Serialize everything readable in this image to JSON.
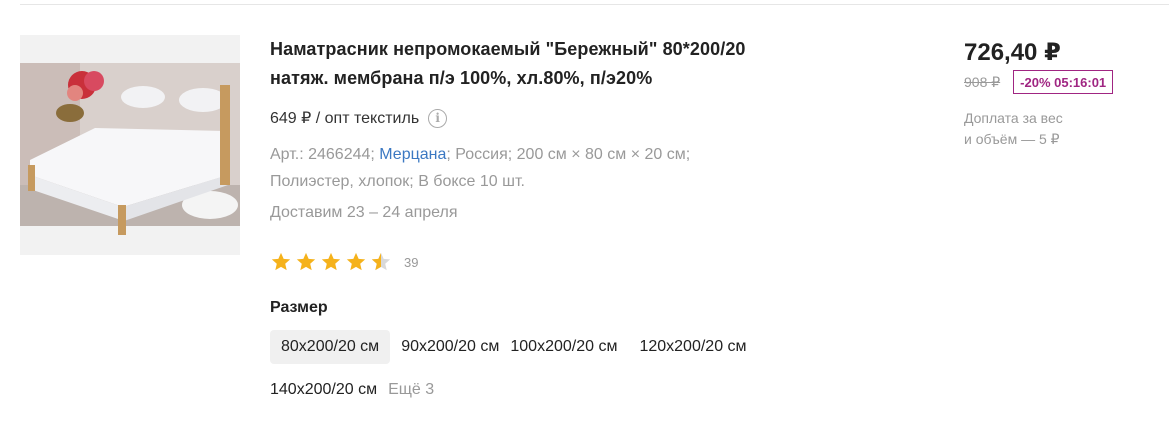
{
  "product": {
    "image_icon": "bed-photo",
    "title_line1": "Наматрасник непромокаемый \"Бережный\" 80*200/20",
    "title_line2": "натяж. мембрана п/э 100%, хл.80%, п/э20%",
    "wholesale_price": "649 ₽ / опт текстиль",
    "info_icon_glyph": "i",
    "specs_prefix": "Арт.: 2466244; ",
    "brand": "Мерцана",
    "specs_suffix_line1": "; Россия; 200 см × 80 см × 20 см;",
    "specs_line2": "Полиэстер, хлопок; В боксе 10 шт.",
    "delivery": "Доставим 23 – 24 апреля",
    "rating": {
      "value": 4.5,
      "max": 5,
      "count": "39",
      "star_color": "#f5b21b",
      "empty_star_color": "#d9d9d9"
    },
    "size_label": "Размер",
    "sizes": [
      {
        "label": "80x200/20 см",
        "selected": true
      },
      {
        "label": "90x200/20 см",
        "selected": false
      },
      {
        "label": "100x200/20 см",
        "selected": false
      },
      {
        "label": "120x200/20 см",
        "selected": false
      },
      {
        "label": "140x200/20 см",
        "selected": false
      }
    ],
    "more_sizes": "Ещё 3"
  },
  "pricing": {
    "price": "726,40 ₽",
    "old_price": "908 ₽",
    "discount_timer": "-20% 05:16:01",
    "discount_color": "#a02582",
    "surcharge_line1": "Доплата за вес",
    "surcharge_line2": "и объём — 5 ₽"
  }
}
